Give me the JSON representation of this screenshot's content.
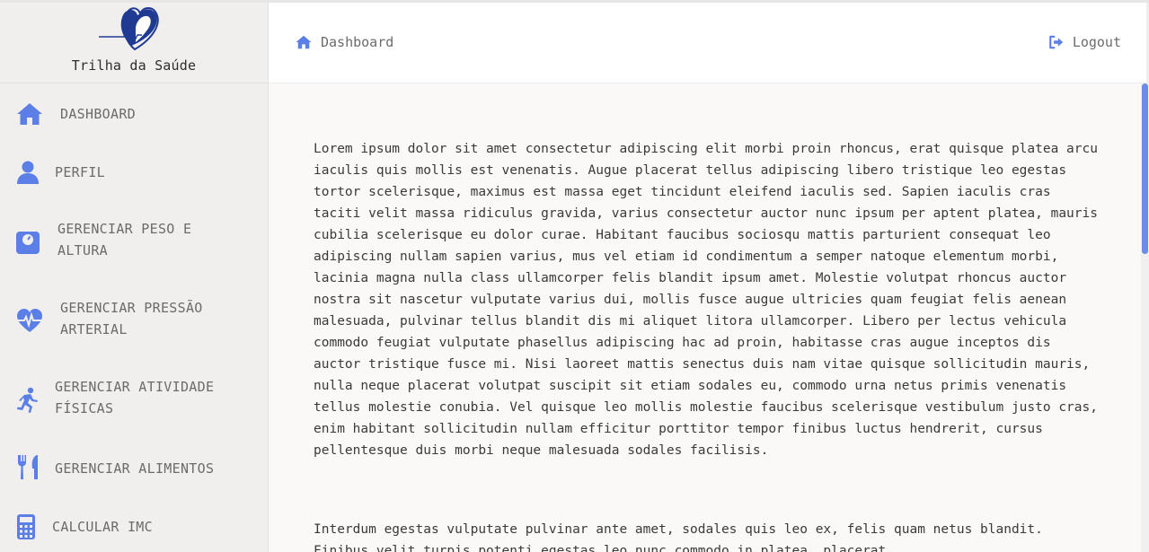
{
  "brand": {
    "name": "Trilha da Saúde",
    "logo_icon": "heart-pulse-logo-icon"
  },
  "header": {
    "breadcrumb": {
      "label": "Dashboard",
      "icon": "home-icon"
    },
    "logout": {
      "label": "Logout",
      "icon": "logout-icon"
    }
  },
  "sidebar": {
    "items": [
      {
        "label": "DASHBOARD",
        "icon": "home-icon"
      },
      {
        "label": "PERFIL",
        "icon": "user-icon"
      },
      {
        "label": "GERENCIAR PESO E",
        "label2": "ALTURA",
        "icon": "weight-scale-icon"
      },
      {
        "label": "GERENCIAR PRESSÃO",
        "label2": "ARTERIAL",
        "icon": "heart-pulse-icon"
      },
      {
        "label": "GERENCIAR ATIVIDADE",
        "label2": "FÍSICAS",
        "icon": "running-icon"
      },
      {
        "label": "GERENCIAR ALIMENTOS",
        "icon": "utensils-icon"
      },
      {
        "label": "CALCULAR IMC",
        "icon": "calculator-icon"
      }
    ]
  },
  "content": {
    "paragraph1": "Lorem ipsum dolor sit amet consectetur adipiscing elit morbi proin rhoncus, erat quisque platea arcu iaculis quis mollis est venenatis. Augue placerat tellus adipiscing libero tristique leo egestas tortor scelerisque, maximus est massa eget tincidunt eleifend iaculis sed. Sapien iaculis cras taciti velit massa ridiculus gravida, varius consectetur auctor nunc ipsum per aptent platea, mauris cubilia scelerisque eu dolor curae. Habitant faucibus sociosqu mattis parturient consequat leo adipiscing nullam sapien varius, mus vel etiam id condimentum a semper natoque elementum morbi, lacinia magna nulla class ullamcorper felis blandit ipsum amet. Molestie volutpat rhoncus auctor nostra sit nascetur vulputate varius dui, mollis fusce augue ultricies quam feugiat felis aenean malesuada, pulvinar tellus blandit dis mi aliquet litora ullamcorper. Libero per lectus vehicula commodo feugiat vulputate phasellus adipiscing hac ad proin, habitasse cras augue inceptos dis auctor tristique fusce mi. Nisi laoreet mattis senectus duis nam vitae quisque sollicitudin mauris, nulla neque placerat volutpat suscipit sit etiam sodales eu, commodo urna netus primis venenatis tellus molestie conubia. Vel quisque leo mollis molestie faucibus scelerisque vestibulum justo cras, enim habitant sollicitudin nullam efficitur porttitor tempor finibus luctus hendrerit, cursus pellentesque duis morbi neque malesuada sodales facilisis.",
    "paragraph2": "Interdum egestas vulputate pulvinar ante amet, sodales quis leo ex, felis quam netus blandit. Finibus velit turpis potenti egestas leo nunc commodo in platea, placerat"
  },
  "colors": {
    "accent": "#5b7fe6",
    "logo": "#1f3a93",
    "sidebar_bg": "#f1efee",
    "content_bg": "#faf9f8"
  }
}
